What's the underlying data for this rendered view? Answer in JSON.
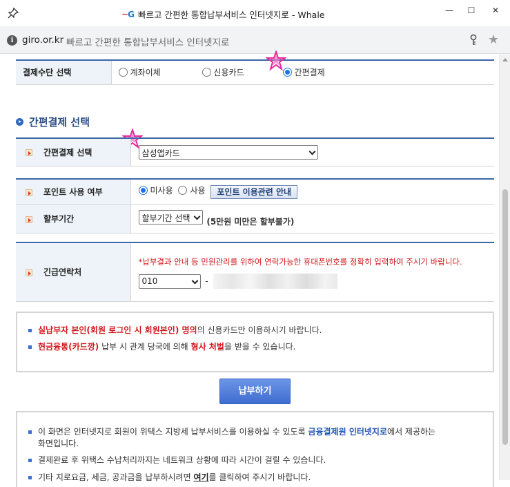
{
  "window": {
    "title": "빠르고 간편한 통합납부서비스 인터넷지로 - Whale",
    "logo_text": "G",
    "minimize": "—",
    "maximize": "☐",
    "close": "✕"
  },
  "addressbar": {
    "url": "giro.or.kr",
    "page_title": "빠르고 간편한 통합납부서비스 인터넷지로"
  },
  "payment_method": {
    "label": "결제수단 선택",
    "options": [
      "계좌이체",
      "신용카드",
      "간편결제"
    ],
    "selected": "간편결제"
  },
  "simple_pay": {
    "section_title": "간편결제 선택",
    "label": "간편결제 선택",
    "selected_value": "삼성앱카드"
  },
  "points": {
    "label": "포인트 사용 여부",
    "options": [
      "미사용",
      "사용"
    ],
    "selected": "미사용",
    "info_button": "포인트 이용관련 안내"
  },
  "installment": {
    "label": "할부기간",
    "selected_value": "할부기간 선택",
    "note": "(5만원 미만은 할부불가)"
  },
  "contact": {
    "label": "긴급연락처",
    "notice": "*납부결과 안내 등 민원관리를 위하여 연락가능한 휴대폰번호를 정확히 입력하여 주시기 바랍니다.",
    "prefix_value": "010",
    "dash": "-"
  },
  "warning": {
    "line1_red": "실납부자 본인(회원 로그인 시 회원본인) 명의",
    "line1_rest": "의 신용카드만 이용하시기 바랍니다.",
    "line2_red": "현금융통(카드깡)",
    "line2_mid": " 납부 시 관계 당국에 의해 ",
    "line2_red2": "형사 처벌",
    "line2_rest": "을 받을 수 있습니다."
  },
  "pay_button": "납부하기",
  "info": {
    "line1_a": "이 화면은 인터넷지로 회원이 위택스 지방세 납부서비스를 이용하실 수 있도록 ",
    "line1_blue": "금융결제원 인터넷지로",
    "line1_b": "에서 제공하는",
    "line1_c": "화면입니다.",
    "line2": "결제완료 후 위택스 수납처리까지는 네트워크 상황에 따라 시간이 걸릴 수 있습니다.",
    "line3_a": "기타 지로요금, 세금, 공과금을 납부하시려면 ",
    "line3_link": "여기",
    "line3_b": "를 클릭하여 주시기 바랍니다."
  }
}
